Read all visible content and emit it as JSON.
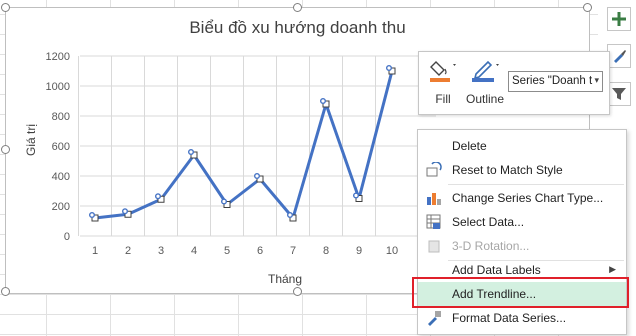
{
  "chart_data": {
    "type": "line",
    "title": "Biểu đồ xu hướng doanh thu",
    "xlabel": "Tháng",
    "ylabel": "Giá trị",
    "categories": [
      "1",
      "2",
      "3",
      "4",
      "5",
      "6",
      "7",
      "8",
      "9",
      "10"
    ],
    "series": [
      {
        "values": [
          120,
          145,
          245,
          540,
          210,
          380,
          120,
          880,
          250,
          1100
        ]
      }
    ],
    "yticks": [
      "0",
      "200",
      "400",
      "600",
      "800",
      "1000",
      "1200"
    ],
    "ylim": [
      0,
      1200
    ],
    "grid": true,
    "line_color": "#4472c4"
  },
  "mini_toolbar": {
    "fill_label": "Fill",
    "outline_label": "Outline",
    "series_select_value": "Series \"Doanh t"
  },
  "side_buttons": {
    "add_icon": "plus-icon",
    "style_icon": "brush-icon",
    "filter_icon": "filter-icon"
  },
  "context_menu": {
    "items": [
      {
        "label": "Delete",
        "icon": ""
      },
      {
        "label": "Reset to Match Style",
        "icon": "reset-icon"
      },
      {
        "label": "Change Series Chart Type...",
        "icon": "chart-type-icon"
      },
      {
        "label": "Select Data...",
        "icon": "select-data-icon"
      },
      {
        "label": "3-D Rotation...",
        "icon": "rotation-icon"
      },
      {
        "label": "Add Data Labels",
        "icon": ""
      },
      {
        "label": "Add Trendline...",
        "icon": ""
      },
      {
        "label": "Format Data Series...",
        "icon": "format-icon"
      }
    ]
  }
}
